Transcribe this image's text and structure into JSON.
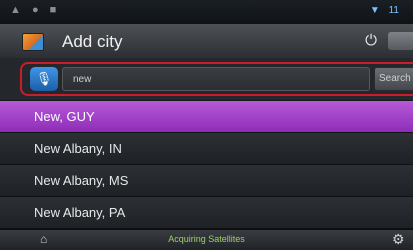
{
  "status_bar": {
    "left_icons": "▲ ● ■",
    "right_text": "▼",
    "right_value": "11"
  },
  "header": {
    "title": "Add city",
    "power_icon": "power-icon",
    "menu_icon": "menu-tab-icon"
  },
  "search": {
    "voice_icon": "microphone-icon",
    "value": "new",
    "button_label": "Search"
  },
  "results": [
    {
      "label": "New, GUY",
      "selected": true
    },
    {
      "label": "New Albany, IN",
      "selected": false
    },
    {
      "label": "New Albany, MS",
      "selected": false
    },
    {
      "label": "New Albany, PA",
      "selected": false
    }
  ],
  "footer": {
    "map_icon": "map-icon",
    "status": "Acquiring Satellites",
    "settings_icon": "gear-icon"
  },
  "colors": {
    "highlight_border": "#c81e2b",
    "selected_row": "#a544cb",
    "status_text": "#9bd06a",
    "mic_button": "#2f7fd0"
  }
}
